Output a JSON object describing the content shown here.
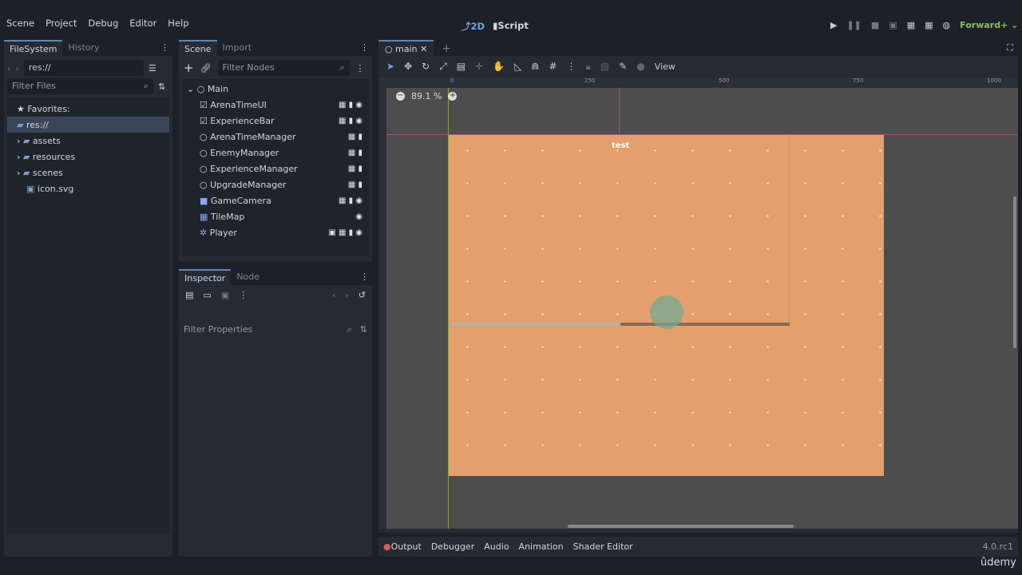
{
  "menu": [
    "Scene",
    "Project",
    "Debug",
    "Editor",
    "Help"
  ],
  "workspace": {
    "view2d": "2D",
    "script": "Script",
    "renderer": "Forward+"
  },
  "filesystem": {
    "tabs": [
      "FileSystem",
      "History"
    ],
    "path": "res://",
    "filter_placeholder": "Filter Files",
    "favorites": "Favorites:",
    "root": "res://",
    "items": [
      "assets",
      "resources",
      "scenes",
      "icon.svg"
    ]
  },
  "scene": {
    "tabs": [
      "Scene",
      "Import"
    ],
    "filter_placeholder": "Filter Nodes",
    "root": "Main",
    "nodes": [
      {
        "name": "ArenaTimeUI",
        "icons": "▦ ▮ ◉"
      },
      {
        "name": "ExperienceBar",
        "icons": "▦ ▮ ◉"
      },
      {
        "name": "ArenaTimeManager",
        "icons": "▦ ▮"
      },
      {
        "name": "EnemyManager",
        "icons": "▦ ▮"
      },
      {
        "name": "ExperienceManager",
        "icons": "▦ ▮"
      },
      {
        "name": "UpgradeManager",
        "icons": "▦ ▮"
      },
      {
        "name": "GameCamera",
        "icons": "▦ ▮ ◉"
      },
      {
        "name": "TileMap",
        "icons": "◉"
      },
      {
        "name": "Player",
        "icons": "▣ ▦ ▮ ◉"
      }
    ]
  },
  "inspector": {
    "tabs": [
      "Inspector",
      "Node"
    ],
    "filter_placeholder": "Filter Properties"
  },
  "viewport": {
    "tab": "main",
    "view_menu": "View",
    "zoom": "89.1 %",
    "ruler": [
      "0",
      "250",
      "500",
      "750",
      "1000"
    ],
    "label": "test"
  },
  "bottom": {
    "tabs": [
      "Output",
      "Debugger",
      "Audio",
      "Animation",
      "Shader Editor"
    ],
    "version": "4.0.rc1"
  },
  "watermark": "ûdemy",
  "colors": {
    "accent": "#5d87b8",
    "ground": "#e3a06c",
    "renderer": "#8fbf5a"
  }
}
